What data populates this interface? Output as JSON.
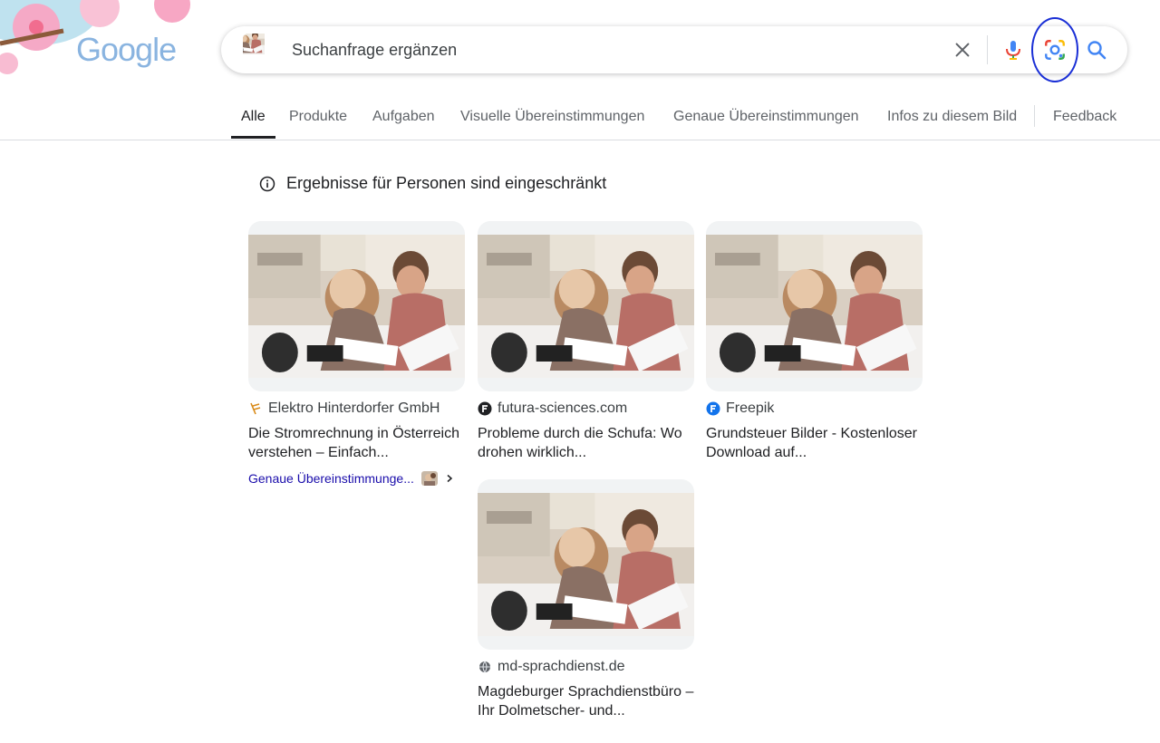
{
  "logo": {
    "text": "Google"
  },
  "search": {
    "value": "",
    "placeholder": "Suchanfrage ergänzen"
  },
  "tabs": [
    {
      "label": "Alle",
      "active": true
    },
    {
      "label": "Produkte"
    },
    {
      "label": "Aufgaben"
    },
    {
      "label": "Visuelle Übereinstimmungen"
    },
    {
      "label": "Genaue Übereinstimmungen"
    },
    {
      "label": "Infos zu diesem Bild"
    },
    {
      "label": "Feedback"
    }
  ],
  "notice": {
    "text": "Ergebnisse für Personen sind eingeschränkt"
  },
  "results": [
    {
      "source": "Elektro Hinterdorfer GmbH",
      "title": "Die Stromrechnung in Österreich verstehen – Einfach...",
      "exact_label": "Genaue Übereinstimmunge..."
    },
    {
      "source": "futura-sciences.com",
      "title": "Probleme durch die Schufa: Wo drohen wirklich..."
    },
    {
      "source": "Freepik",
      "title": "Grundsteuer Bilder - Kostenloser Download auf..."
    },
    {
      "source": "md-sprachdienst.de",
      "title": "Magdeburger Sprachdienstbüro – Ihr Dolmetscher- und..."
    }
  ],
  "colors": {
    "lens_highlight": "#1a2fd6",
    "link": "#1a0dab",
    "accent_blue": "#4285f4"
  }
}
